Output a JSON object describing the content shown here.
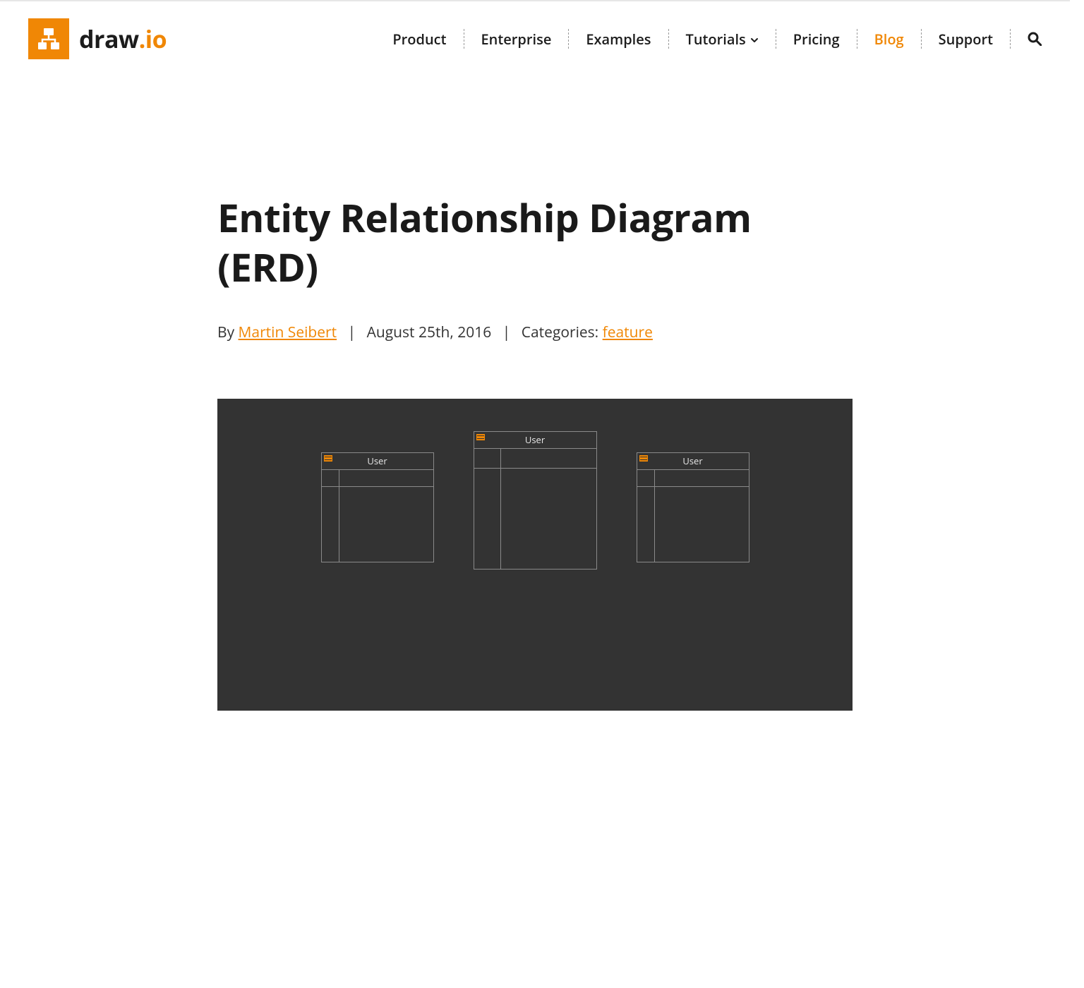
{
  "brand": {
    "name_prefix": "draw",
    "name_dot": ".",
    "name_suffix": "io"
  },
  "nav": {
    "items": [
      {
        "label": "Product",
        "active": false,
        "has_chevron": false
      },
      {
        "label": "Enterprise",
        "active": false,
        "has_chevron": false
      },
      {
        "label": "Examples",
        "active": false,
        "has_chevron": false
      },
      {
        "label": "Tutorials",
        "active": false,
        "has_chevron": true
      },
      {
        "label": "Pricing",
        "active": false,
        "has_chevron": false
      },
      {
        "label": "Blog",
        "active": true,
        "has_chevron": false
      },
      {
        "label": "Support",
        "active": false,
        "has_chevron": false
      }
    ]
  },
  "article": {
    "title": "Entity Relationship Diagram (ERD)",
    "by_prefix": "By ",
    "author": "Martin Seibert",
    "date": "August 25th, 2016",
    "categories_label": "Categories: ",
    "category": "feature",
    "separator": "|"
  },
  "hero": {
    "entity_label": "User"
  }
}
